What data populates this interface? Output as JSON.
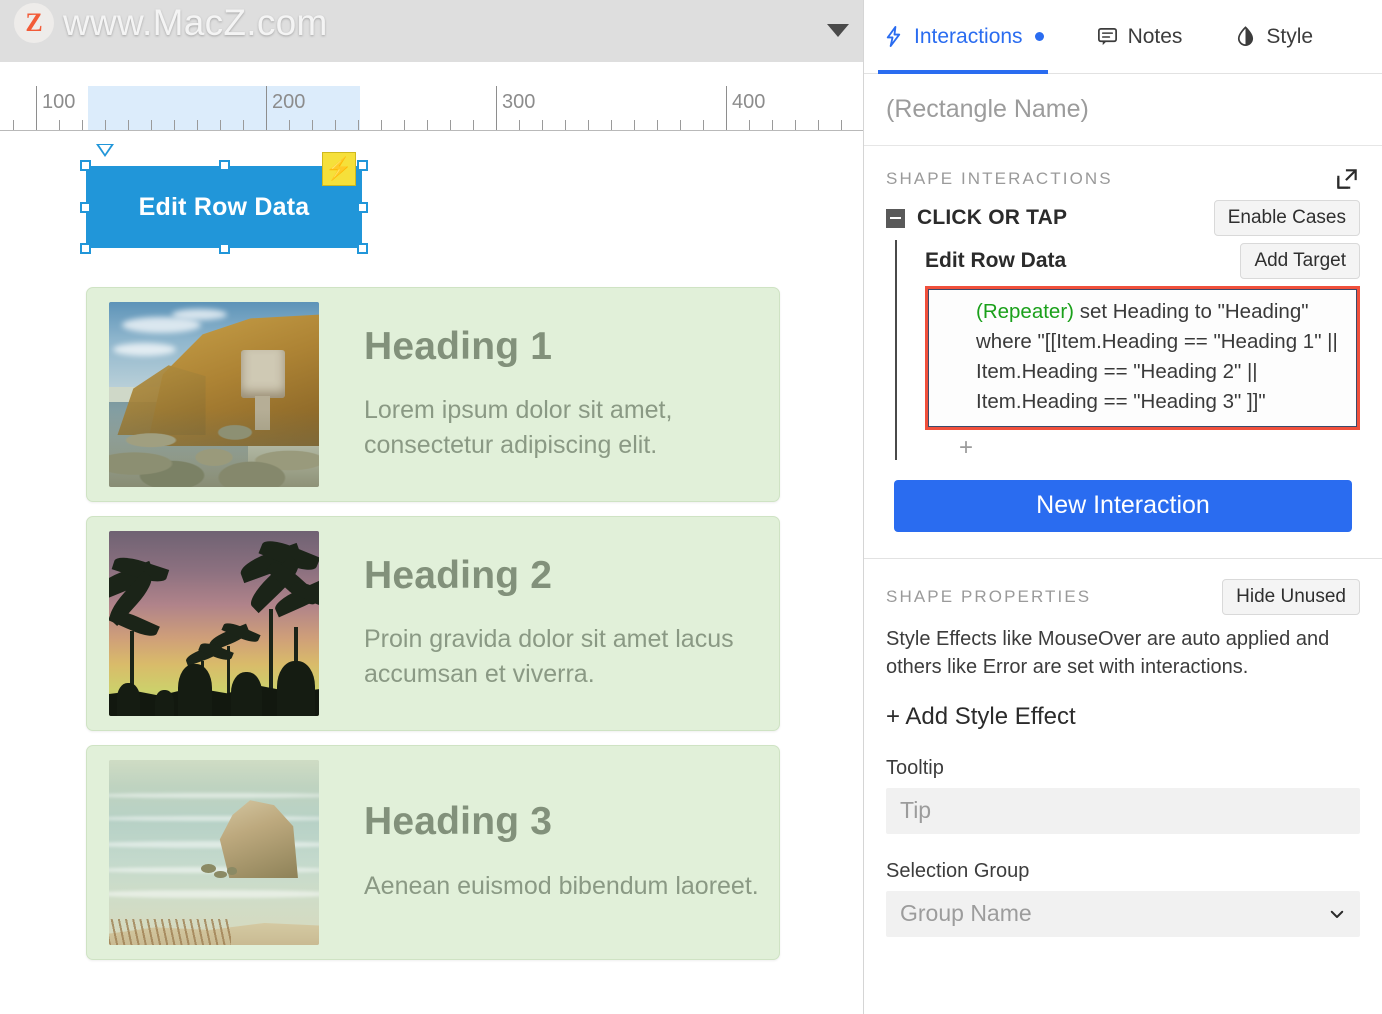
{
  "watermark": {
    "text": "www.MacZ.com",
    "badge_letter": "Z",
    "badge_color": "#f4502a"
  },
  "canvas": {
    "ruler": {
      "labels": [
        "100",
        "200",
        "300",
        "400"
      ]
    },
    "shape": {
      "label": "Edit Row Data",
      "fill": "#2196d9",
      "badge_icon": "lightning-icon"
    },
    "cards": [
      {
        "heading": "Heading 1",
        "text": "Lorem ipsum dolor sit amet, consectetur adipiscing elit.",
        "image": "coastal-cliff-photo"
      },
      {
        "heading": "Heading 2",
        "text": "Proin gravida dolor sit amet lacus accumsan et viverra.",
        "image": "sunset-palm-trees-photo"
      },
      {
        "heading": "Heading 3",
        "text": "Aenean euismod bibendum laoreet.",
        "image": "beach-rock-photo"
      }
    ],
    "card_bg": "#e1f0d9",
    "heading_color": "#82917b"
  },
  "panel": {
    "tabs": [
      {
        "label": "Interactions",
        "icon": "lightning-icon",
        "active": true,
        "dot": true
      },
      {
        "label": "Notes",
        "icon": "note-icon",
        "active": false,
        "dot": false
      },
      {
        "label": "Style",
        "icon": "style-icon",
        "active": false,
        "dot": false
      }
    ],
    "accent": "#2a6cf0",
    "name_field": {
      "value": "",
      "placeholder": "(Rectangle Name)"
    },
    "shape_interactions": {
      "title": "SHAPE INTERACTIONS",
      "expand_icon": "external-link-icon",
      "trigger": "CLICK OR TAP",
      "enable_cases_label": "Enable Cases",
      "target": "Edit Row Data",
      "add_target_label": "Add Target",
      "action": {
        "prefix": "(Repeater)",
        "body": " set Heading to \"Heading\" where \"[[Item.Heading == \"Heading 1\" || Item.Heading == \"Heading 2\"  || Item.Heading == \"Heading 3\" ]]\"",
        "highlight_color": "#f0503c",
        "prefix_color": "#1aa01a"
      },
      "add_action_label": "+",
      "new_interaction_label": "New Interaction"
    },
    "shape_properties": {
      "title": "SHAPE PROPERTIES",
      "hide_unused_label": "Hide Unused",
      "description": "Style Effects like MouseOver are auto applied and others like Error are set with interactions.",
      "add_style_effect_label": "+ Add Style Effect",
      "tooltip_label": "Tooltip",
      "tooltip_placeholder": "Tip",
      "tooltip_value": "",
      "selection_group_label": "Selection Group",
      "selection_group_placeholder": "Group Name",
      "selection_group_value": ""
    }
  }
}
